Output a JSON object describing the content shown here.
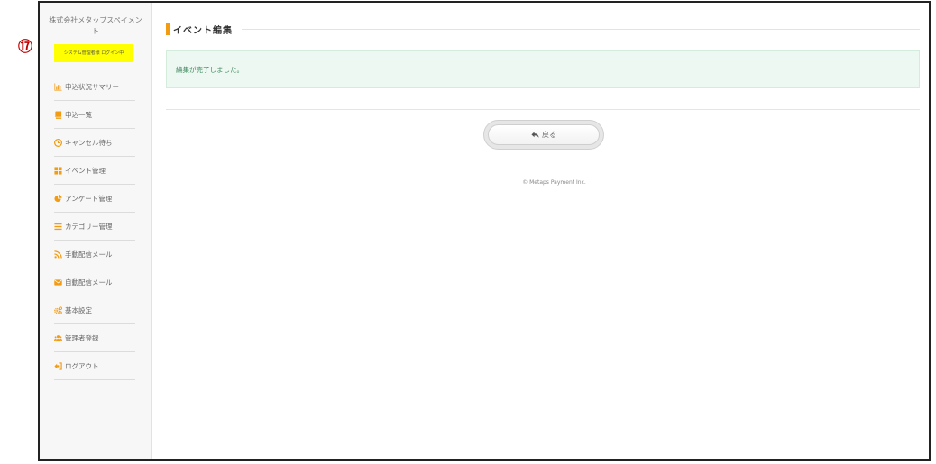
{
  "annotation": {
    "number": "⑰"
  },
  "sidebar": {
    "company_name": "株式会社メタップスペイメント",
    "login_status": "システム管理者様 ログイン中",
    "items": [
      {
        "label": "申込状況サマリー",
        "icon": "bar-chart-icon",
        "color": "#f39c12"
      },
      {
        "label": "申込一覧",
        "icon": "book-icon",
        "color": "#f39c12"
      },
      {
        "label": "キャンセル待ち",
        "icon": "clock-icon",
        "color": "#f39c12"
      },
      {
        "label": "イベント管理",
        "icon": "grid-icon",
        "color": "#f39c12"
      },
      {
        "label": "アンケート管理",
        "icon": "pie-chart-icon",
        "color": "#f39c12"
      },
      {
        "label": "カテゴリー管理",
        "icon": "list-icon",
        "color": "#f39c12"
      },
      {
        "label": "手動配信メール",
        "icon": "rss-icon",
        "color": "#f39c12"
      },
      {
        "label": "自動配信メール",
        "icon": "envelope-icon",
        "color": "#f39c12"
      },
      {
        "label": "基本設定",
        "icon": "gears-icon",
        "color": "#f39c12"
      },
      {
        "label": "管理者登録",
        "icon": "users-icon",
        "color": "#f39c12"
      },
      {
        "label": "ログアウト",
        "icon": "sign-out-icon",
        "color": "#f39c12"
      }
    ]
  },
  "main": {
    "title": "イベント編集",
    "alert_message": "編集が完了しました。",
    "back_button_label": "戻る",
    "back_icon": "reply-arrow-icon",
    "copyright": "© Metaps Payment Inc."
  },
  "colors": {
    "accent": "#f39c12",
    "login_highlight": "#ffff00",
    "success_bg": "#eef8f2",
    "success_text": "#3f8a5e",
    "annotation": "#c00000"
  }
}
